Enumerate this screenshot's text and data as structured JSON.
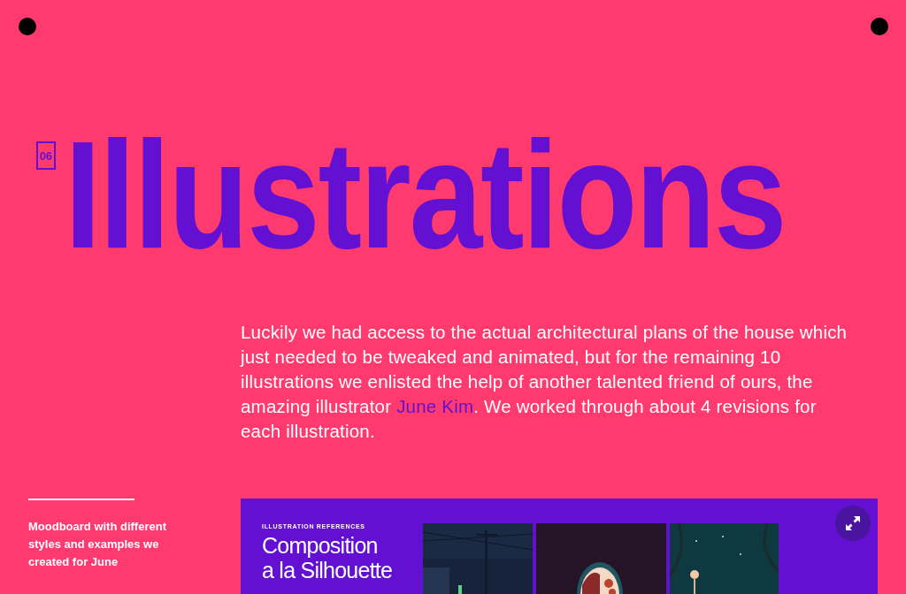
{
  "section": {
    "number": "06",
    "title": "Illustrations"
  },
  "intro": {
    "before": "Luckily we had access to the actual architectural plans of the house which just needed to be tweaked and animated, but for the remaining 10 illustrations we enlisted the help of another talented friend of ours, the amazing illustrator ",
    "link": "June Kim",
    "after": ". We worked through about 4 revisions for each illustration."
  },
  "figure": {
    "caption": "Moodboard with different styles and examples we created for June",
    "board": {
      "label": "ILLUSTRATION REFERENCES",
      "title": "Composition a la Silhouette"
    }
  }
}
